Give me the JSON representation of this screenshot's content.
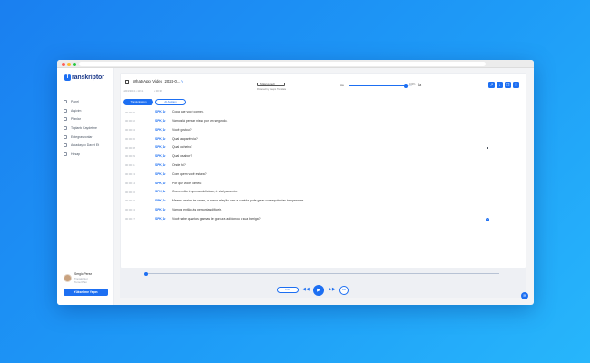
{
  "sidebar": {
    "logo_mark": "T",
    "logo_text": "ranskriptor",
    "items": [
      {
        "label": "Panel",
        "icon": "grid-icon"
      },
      {
        "label": "Arşivim",
        "icon": "archive-icon"
      },
      {
        "label": "Planlar",
        "icon": "plans-icon"
      },
      {
        "label": "Toplantı Kaydetme",
        "icon": "meeting-icon"
      },
      {
        "label": "Entegrasyonlar",
        "icon": "integrations-icon"
      },
      {
        "label": "Arkadaşını Davet Et",
        "icon": "invite-icon"
      },
      {
        "label": "Hesap",
        "icon": "account-icon"
      }
    ],
    "user": {
      "name": "Sergio Perez",
      "sub1": "Transkriptor",
      "sub2": "Temel Plan"
    },
    "upgrade_label": "Yükseltme Yapın"
  },
  "header": {
    "file_title": "WhatsApp_Video_2024-0...",
    "meta_date": "11/03/2024 • 13:44",
    "meta_duration": "• 00:36",
    "language_select": "Türkçe'ye çevir",
    "powered_by": "Powered by DeepL Translate",
    "slider_min": "Aa",
    "slider_value": "100%",
    "slider_max": "Aa",
    "slider_level": 0.9,
    "tool_icons": [
      "share-icon",
      "download-icon",
      "copy-icon",
      "subtitle-icon"
    ]
  },
  "chips": {
    "primary": "Transkripsiyon",
    "secondary": "AI Asistanı"
  },
  "rows": [
    {
      "time": "00:00:00",
      "speaker": "SPK_1",
      "text": "Coca que você comeu.",
      "marker": ""
    },
    {
      "time": "00:00:02",
      "speaker": "SPK_1",
      "text": "Vamos lá pensar nisso por um segundo.",
      "marker": ""
    },
    {
      "time": "00:00:04",
      "speaker": "SPK_1",
      "text": "Você gostou?",
      "marker": ""
    },
    {
      "time": "00:00:06",
      "speaker": "SPK_1",
      "text": "Qual a aparência?",
      "marker": ""
    },
    {
      "time": "00:00:08",
      "speaker": "SPK_1",
      "text": "Qual o cheiro?",
      "marker": "dot"
    },
    {
      "time": "00:00:09",
      "speaker": "SPK_1",
      "text": "Qual o sabor?",
      "marker": ""
    },
    {
      "time": "00:00:11",
      "speaker": "SPK_1",
      "text": "Onde foi?",
      "marker": ""
    },
    {
      "time": "00:00:13",
      "speaker": "SPK_1",
      "text": "Com quem você estava?",
      "marker": ""
    },
    {
      "time": "00:00:14",
      "speaker": "SPK_1",
      "text": "Por que você comeu?",
      "marker": ""
    },
    {
      "time": "00:00:16",
      "speaker": "SPK_1",
      "text": "Comer não é apenas delicioso, é vital para nós.",
      "marker": ""
    },
    {
      "time": "00:00:19",
      "speaker": "SPK_1",
      "text": "Mesmo assim, às vezes, a nossa relação com a comida pode gerar consequências inesperadas.",
      "marker": ""
    },
    {
      "time": "00:00:24",
      "speaker": "SPK_1",
      "text": "Vamos, então, às perguntas difíceis.",
      "marker": ""
    },
    {
      "time": "00:00:27",
      "speaker": "SPK_1",
      "text": "Você sabe quantos gramas de gordura adicionou à sua barriga?",
      "marker": "check"
    }
  ],
  "player": {
    "progress": 0.0,
    "speed_label": "1.0X",
    "volume_label": "100",
    "controls": [
      "rewind-icon",
      "play-icon",
      "forward-icon"
    ]
  },
  "colors": {
    "accent": "#1d6ff2",
    "background": "#1e9bf7"
  }
}
